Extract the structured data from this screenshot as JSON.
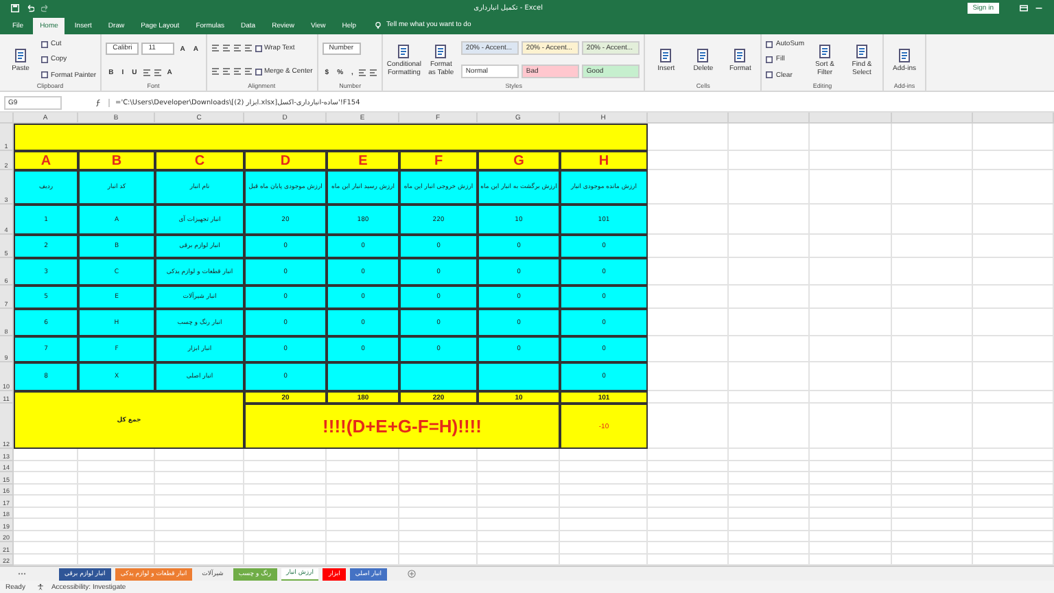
{
  "window": {
    "title": "تکمیل انبارداری - Excel",
    "sign_in": "Sign in"
  },
  "ribbon_tabs": [
    {
      "label": "File",
      "selected": false
    },
    {
      "label": "Home",
      "selected": true
    },
    {
      "label": "Insert",
      "selected": false
    },
    {
      "label": "Draw",
      "selected": false
    },
    {
      "label": "Page Layout",
      "selected": false
    },
    {
      "label": "Formulas",
      "selected": false
    },
    {
      "label": "Data",
      "selected": false
    },
    {
      "label": "Review",
      "selected": false
    },
    {
      "label": "View",
      "selected": false
    },
    {
      "label": "Help",
      "selected": false
    }
  ],
  "tell_me": "Tell me what you want to do",
  "ribbon_groups": [
    {
      "name": "Clipboard",
      "columns": [
        [
          [
            {
              "kind": "large",
              "label": "Paste"
            }
          ]
        ],
        [
          [
            {
              "kind": "small",
              "label": "Cut"
            }
          ],
          [
            {
              "kind": "small",
              "label": "Copy"
            }
          ],
          [
            {
              "kind": "small",
              "label": "Format Painter"
            }
          ]
        ]
      ]
    },
    {
      "name": "Font",
      "columns": [
        [
          [
            {
              "kind": "field",
              "label": "Calibri"
            },
            {
              "kind": "field",
              "label": "11"
            },
            {
              "kind": "glyph",
              "label": "A"
            },
            {
              "kind": "glyph",
              "label": "A"
            }
          ],
          [
            {
              "kind": "glyph",
              "label": "B"
            },
            {
              "kind": "glyph",
              "label": "I"
            },
            {
              "kind": "glyph",
              "label": "U"
            },
            {
              "kind": "icon"
            },
            {
              "kind": "icon"
            },
            {
              "kind": "glyph",
              "label": "A"
            }
          ]
        ]
      ]
    },
    {
      "name": "Alignment",
      "columns": [
        [
          [
            {
              "kind": "icon"
            },
            {
              "kind": "icon"
            },
            {
              "kind": "icon"
            },
            {
              "kind": "icon"
            },
            {
              "kind": "small",
              "label": "Wrap Text"
            }
          ],
          [
            {
              "kind": "icon"
            },
            {
              "kind": "icon"
            },
            {
              "kind": "icon"
            },
            {
              "kind": "icon"
            },
            {
              "kind": "small",
              "label": "Merge & Center"
            }
          ]
        ]
      ]
    },
    {
      "name": "Number",
      "columns": [
        [
          [
            {
              "kind": "field",
              "label": "Number"
            }
          ],
          [
            {
              "kind": "glyph",
              "label": "$"
            },
            {
              "kind": "glyph",
              "label": "%"
            },
            {
              "kind": "glyph",
              "label": ","
            },
            {
              "kind": "icon"
            },
            {
              "kind": "icon"
            }
          ]
        ]
      ]
    },
    {
      "name": "Styles",
      "columns": [
        [
          [
            {
              "kind": "large",
              "label": "Conditional Formatting"
            }
          ]
        ],
        [
          [
            {
              "kind": "large",
              "label": "Format as Table"
            }
          ]
        ],
        [
          [
            {
              "kind": "style",
              "label": "20% - Accent...",
              "color": "#dce6f2"
            },
            {
              "kind": "style",
              "label": "20% - Accent...",
              "color": "#fdf2d0"
            },
            {
              "kind": "style",
              "label": "20% - Accent...",
              "color": "#e3efda"
            }
          ],
          [
            {
              "kind": "style",
              "label": "Normal",
              "color": "#ffffff"
            },
            {
              "kind": "style",
              "label": "Bad",
              "color": "#ffc7ce"
            },
            {
              "kind": "style",
              "label": "Good",
              "color": "#c6efce"
            }
          ]
        ]
      ]
    },
    {
      "name": "Cells",
      "columns": [
        [
          [
            {
              "kind": "large",
              "label": "Insert"
            }
          ]
        ],
        [
          [
            {
              "kind": "large",
              "label": "Delete"
            }
          ]
        ],
        [
          [
            {
              "kind": "large",
              "label": "Format"
            }
          ]
        ]
      ]
    },
    {
      "name": "Editing",
      "columns": [
        [
          [
            {
              "kind": "small",
              "label": "AutoSum"
            }
          ],
          [
            {
              "kind": "small",
              "label": "Fill"
            }
          ],
          [
            {
              "kind": "small",
              "label": "Clear"
            }
          ]
        ],
        [
          [
            {
              "kind": "large",
              "label": "Sort & Filter"
            }
          ]
        ],
        [
          [
            {
              "kind": "large",
              "label": "Find & Select"
            }
          ]
        ]
      ]
    },
    {
      "name": "Add-ins",
      "columns": [
        [
          [
            {
              "kind": "large",
              "label": "Add-ins"
            }
          ]
        ]
      ]
    }
  ],
  "name_box": "G9",
  "formula": "='C:\\Users\\Developer\\Downloads\\[ابزار (2).xlsx]ساده-انبارداری-اکسل'!F154",
  "sheet": {
    "column_headers": [
      "A",
      "B",
      "C",
      "D",
      "E",
      "F",
      "G",
      "H"
    ],
    "row_numbers": [
      "1",
      "2",
      "3",
      "4",
      "5",
      "6",
      "7",
      "8",
      "9",
      "10",
      "11",
      "12",
      "13",
      "14",
      "15",
      "16",
      "17",
      "18",
      "19",
      "20",
      "21",
      "22"
    ],
    "letter_row": [
      "A",
      "B",
      "C",
      "D",
      "E",
      "F",
      "G",
      "H"
    ],
    "header_row": [
      "ارزش مانده موجودی انبار",
      "ارزش برگشت به انبار این ماه",
      "ارزش خروجی انبار این ماه",
      "ارزش رسید انبار این ماه",
      "ارزش موجودی پایان ماه قبل",
      "نام انبار",
      "کد انبار",
      "ردیف"
    ],
    "data_rows": [
      [
        "1",
        "A",
        "انبار تجهیزات آی",
        "20",
        "180",
        "220",
        "10",
        "101"
      ],
      [
        "2",
        "B",
        "انبار لوازم برقی",
        "0",
        "0",
        "0",
        "0",
        "0"
      ],
      [
        "3",
        "C",
        "انبار قطعات و لوازم یدکی",
        "0",
        "0",
        "0",
        "0",
        "0"
      ],
      [
        "5",
        "E",
        "انبار شیرآلات",
        "0",
        "0",
        "0",
        "0",
        "0"
      ],
      [
        "6",
        "H",
        "انبار رنگ و چسب",
        "0",
        "0",
        "0",
        "0",
        "0"
      ],
      [
        "7",
        "F",
        "انبار ابزار",
        "0",
        "0",
        "0",
        "0",
        "0"
      ],
      [
        "8",
        "X",
        "انبار اصلی",
        "0",
        null,
        null,
        null,
        "0"
      ]
    ],
    "totals": [
      "20",
      "180",
      "220",
      "10",
      "101"
    ],
    "total_label": "جمع کل",
    "check_formula": "!!!!(D+E+G-F=H)!!!!",
    "difference": "-10"
  },
  "sheet_tabs": [
    {
      "label": "انبار اصلی",
      "color": "#4472c4",
      "selected": false
    },
    {
      "label": "ابزار",
      "color": "#ff0000",
      "selected": false
    },
    {
      "label": "ارزش انبار",
      "color": "#70ad47",
      "selected": true
    },
    {
      "label": "رنگ و چسب",
      "color": "#70ad47",
      "selected": false
    },
    {
      "label": "شیرآلات",
      "selected": false
    },
    {
      "label": "انبار قطعات و لوازم یدکی",
      "color": "#ed7d31",
      "selected": false
    },
    {
      "label": "انبار لوازم برقی",
      "color": "#2f5597",
      "selected": false
    }
  ],
  "status_bar": {
    "mode": "Ready",
    "accessibility": "Accessibility: Investigate"
  }
}
